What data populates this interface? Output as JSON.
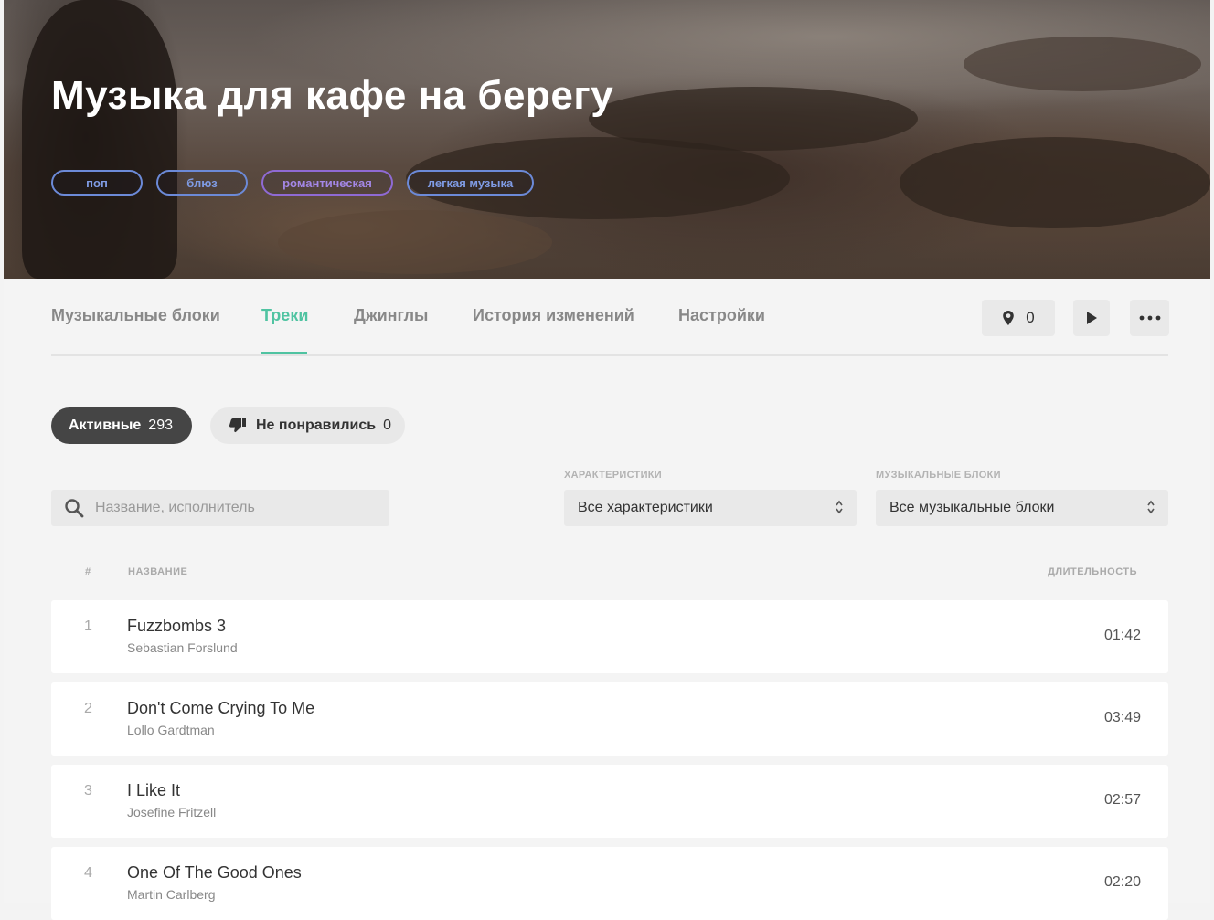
{
  "playlist": {
    "title": "Музыка для кафе на берегу",
    "tags": [
      "поп",
      "блюз",
      "романтическая",
      "легкая музыка"
    ]
  },
  "tabs": [
    {
      "label": "Музыкальные блоки"
    },
    {
      "label": "Треки",
      "active": true
    },
    {
      "label": "Джинглы"
    },
    {
      "label": "История изменений"
    },
    {
      "label": "Настройки"
    }
  ],
  "toolbar": {
    "location_count": "0"
  },
  "filters": {
    "active": {
      "label": "Активные",
      "count": "293"
    },
    "disliked": {
      "label": "Не понравились",
      "count": "0"
    }
  },
  "search": {
    "placeholder": "Название, исполнитель"
  },
  "characteristics": {
    "label": "ХАРАКТЕРИСТИКИ",
    "value": "Все характеристики"
  },
  "music_blocks": {
    "label": "МУЗЫКАЛЬНЫЕ БЛОКИ",
    "value": "Все музыкальные блоки"
  },
  "table": {
    "headers": {
      "num": "#",
      "name": "НАЗВАНИЕ",
      "duration": "ДЛИТЕЛЬНОСТЬ"
    },
    "rows": [
      {
        "num": "1",
        "title": "Fuzzbombs 3",
        "artist": "Sebastian Forslund",
        "duration": "01:42"
      },
      {
        "num": "2",
        "title": "Don't Come Crying To Me",
        "artist": "Lollo Gardtman",
        "duration": "03:49"
      },
      {
        "num": "3",
        "title": "I Like It",
        "artist": "Josefine Fritzell",
        "duration": "02:57"
      },
      {
        "num": "4",
        "title": "One Of The Good Ones",
        "artist": "Martin Carlberg",
        "duration": "02:20"
      }
    ]
  },
  "colors": {
    "accent": "#4fc3a1",
    "tag_blue": "#7f9be4",
    "tag_purple": "#a487e6",
    "chip_dark": "#454545"
  }
}
